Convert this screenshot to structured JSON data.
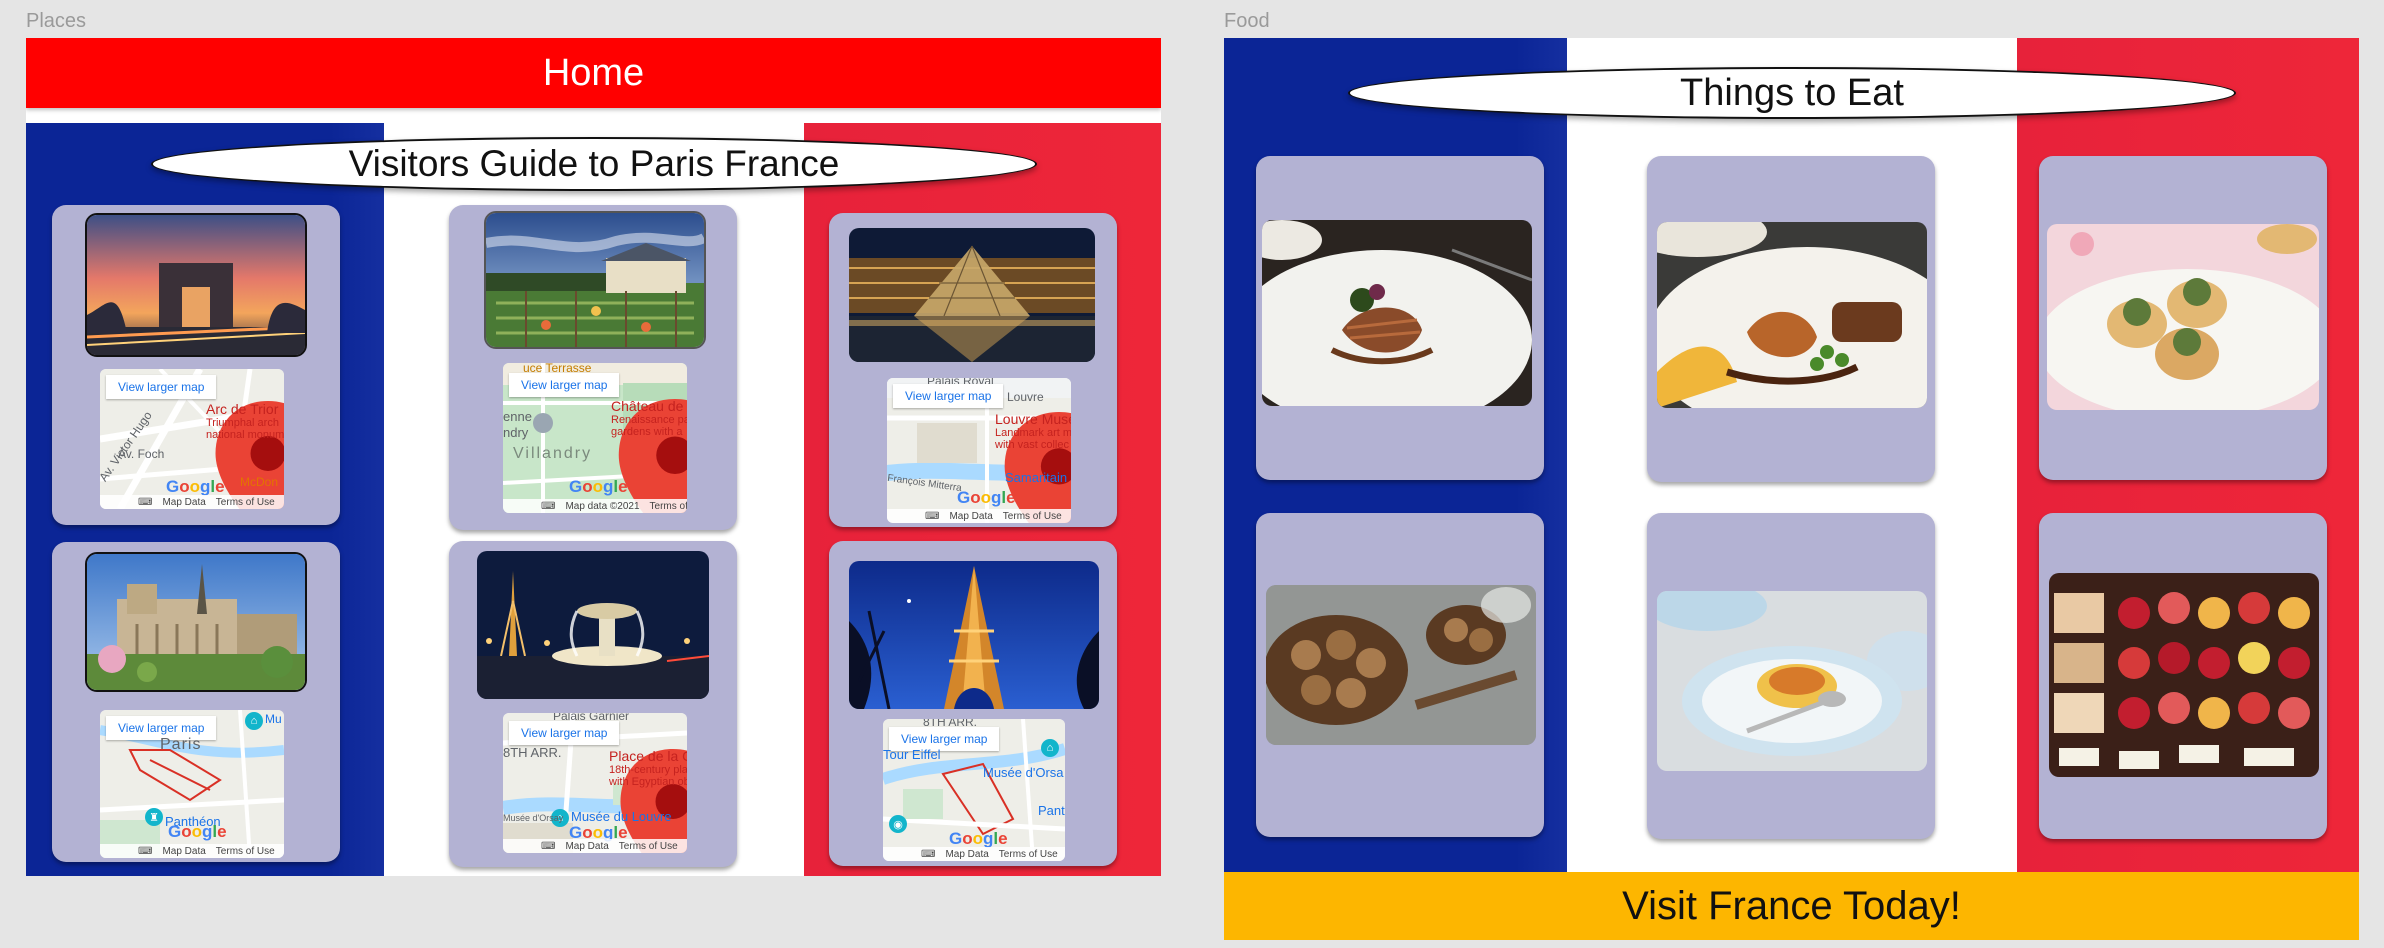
{
  "frames": {
    "places_label": "Places",
    "food_label": "Food"
  },
  "places": {
    "header": "Home",
    "title": "Visitors Guide to Paris France",
    "map_button": "View larger map",
    "map_data": "Map Data",
    "map_data_2021": "Map data ©2021",
    "terms": "Terms of Use",
    "google": [
      "G",
      "o",
      "o",
      "g",
      "l",
      "e"
    ],
    "maps": [
      {
        "place": "Arc de Trior",
        "desc1": "Triumphal arch",
        "desc2": "national monum",
        "streets": [
          "Av. Foch",
          "Av. Victor Hugo",
          "McDon"
        ],
        "top_text": ""
      },
      {
        "place": "Château de",
        "desc1": "Renaissance pa",
        "desc2": "gardens with a",
        "streets": [
          "Villandry",
          "enne",
          "ndry"
        ],
        "top_text": "uce Terrasse"
      },
      {
        "place": "Louvre Muse",
        "desc1": "Landmark art m",
        "desc2": "with vast collec",
        "streets": [
          "Samaritain",
          "François Mitterra",
          "u Louvre"
        ],
        "top_text": "Palais Royal"
      },
      {
        "place": "",
        "desc1": "",
        "desc2": "",
        "streets": [
          "Paris",
          "Panthéon",
          "Mu"
        ],
        "top_text": ""
      },
      {
        "place": "Place de la C",
        "desc1": "18th-century pla",
        "desc2": "with Egyptian ob",
        "streets": [
          "Palais Garnier",
          "8TH ARR.",
          "Musée du Louvre",
          "Musée d'Orsay"
        ],
        "top_text": ""
      },
      {
        "place": "",
        "desc1": "",
        "desc2": "",
        "streets": [
          "8TH ARR.",
          "Tour Eiffel",
          "Musée d'Orsa",
          "Pant"
        ],
        "top_text": ""
      }
    ]
  },
  "food": {
    "title": "Things to Eat",
    "footer": "Visit France Today!"
  },
  "colors": {
    "france_blue": "#0b2596",
    "france_red": "#ee2639",
    "header_red": "#ff0000",
    "card": "#b3b2d3",
    "gold": "#fdb600"
  }
}
